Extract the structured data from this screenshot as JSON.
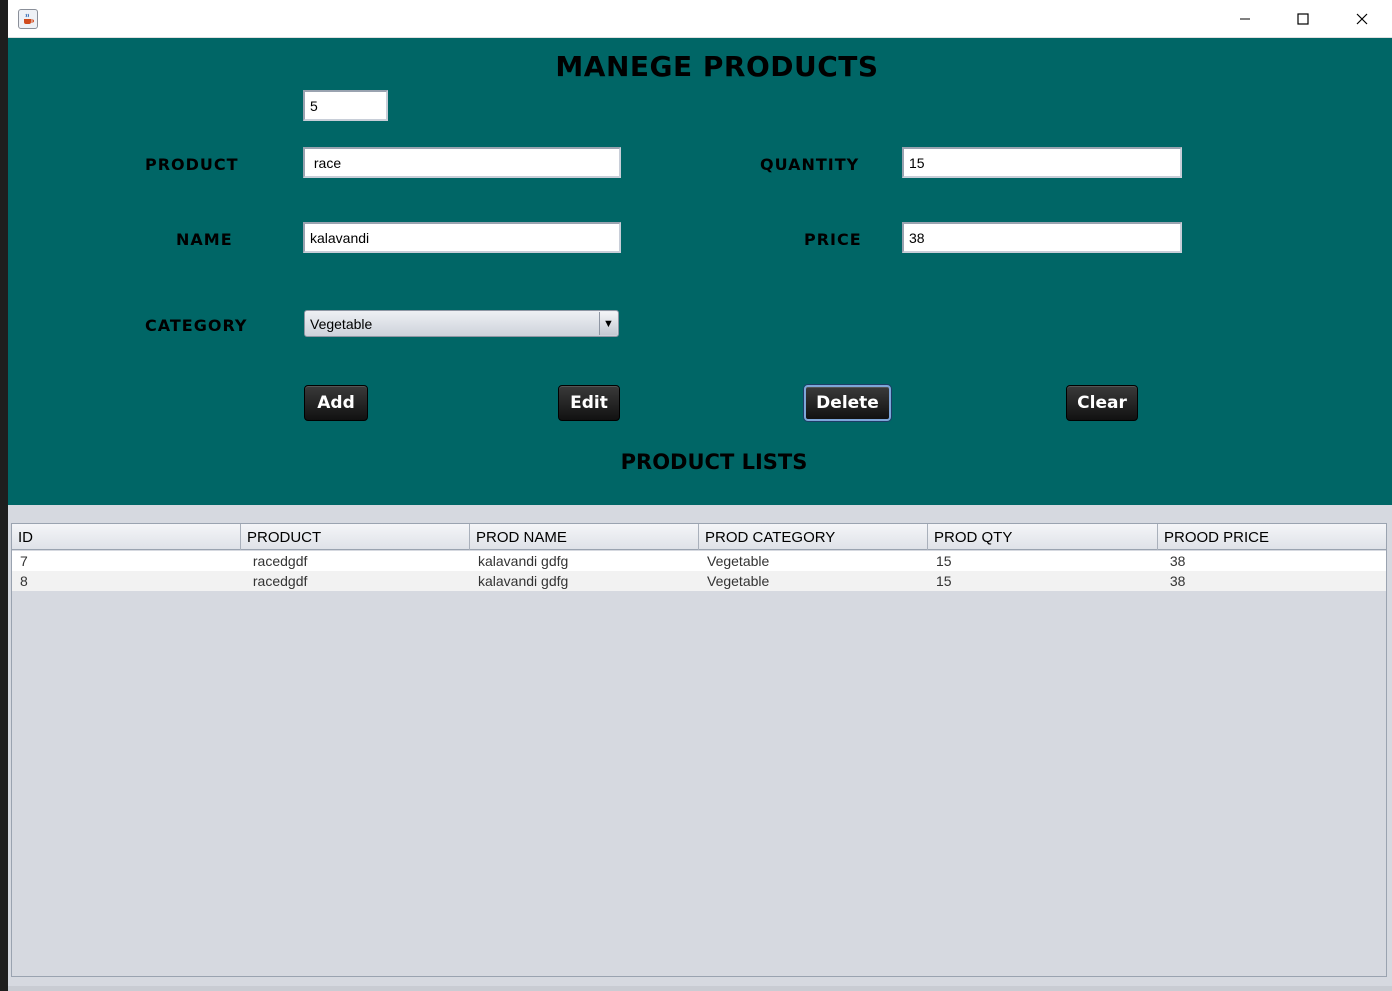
{
  "window": {
    "title": ""
  },
  "header": {
    "title": "MANEGE PRODUCTS",
    "subtitle": "PRODUCT LISTS"
  },
  "form": {
    "id_value": "5",
    "product_label": "PRODUCT",
    "product_value": " race",
    "name_label": "NAME",
    "name_value": "kalavandi",
    "quantity_label": "QUANTITY",
    "quantity_value": "15",
    "price_label": "PRICE",
    "price_value": "38",
    "category_label": "CATEGORY",
    "category_value": "Vegetable"
  },
  "buttons": {
    "add": "Add",
    "edit": "Edit",
    "delete": "Delete",
    "clear": "Clear"
  },
  "table": {
    "columns": [
      "ID",
      "PRODUCT",
      "PROD NAME",
      "PROD CATEGORY",
      "PROD QTY",
      "PROOD PRICE"
    ],
    "rows": [
      [
        "7",
        " racedgdf",
        "kalavandi gdfg",
        "Vegetable",
        "15",
        " 38"
      ],
      [
        "8",
        " racedgdf",
        "kalavandi gdfg",
        "Vegetable",
        "15",
        " 38"
      ]
    ]
  },
  "colors": {
    "panel": "#006666",
    "table_bg": "#d6d9e0",
    "button": "#1a1a1a"
  },
  "icons": {
    "app": "java-cup-icon",
    "minimize": "minimize-icon",
    "maximize": "maximize-icon",
    "close": "close-icon",
    "dropdown": "chevron-down-icon"
  }
}
